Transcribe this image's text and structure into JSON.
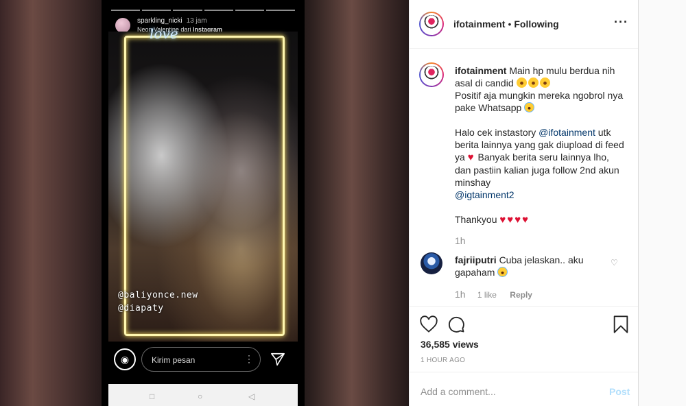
{
  "story": {
    "username": "sparkling_nicki",
    "time": "13 jam",
    "sub_effect": "Neon Valentine",
    "sub_from": "dari",
    "sub_source": "Instagram",
    "overlay_text": "love",
    "tags": [
      "@baliyonce.new",
      "@diapaty"
    ],
    "reply_placeholder": "Kirim pesan"
  },
  "post": {
    "account": "ifotainment",
    "follow_status": "Following",
    "caption": {
      "username": "ifotainment",
      "line1": "Main hp mulu berdua nih asal di candid",
      "line2": "Positif aja mungkin mereka ngobrol nya pake Whatsapp",
      "line3_pre": "Halo cek instastory",
      "line3_mention": "@ifotainment",
      "line3_post": "utk berita lainnya yang gak diupload di feed ya",
      "line4": "Banyak berita seru lainnya lho, dan pastiin kalian juga follow 2nd akun minshay",
      "line5_mention": "@igtainment2",
      "line6": "Thankyou",
      "time": "1h"
    },
    "comment": {
      "username": "fajriiputri",
      "text": "Cuba jelaskan.. aku gapaham",
      "time": "1h",
      "likes": "1 like",
      "reply": "Reply"
    },
    "views": "36,585 views",
    "posted_ago": "1 HOUR AGO",
    "add_comment_placeholder": "Add a comment...",
    "post_label": "Post"
  },
  "colors": {
    "link": "#003569",
    "heart": "#dd1133",
    "post_button": "#b2dffc",
    "muted": "#8e8e8e"
  }
}
